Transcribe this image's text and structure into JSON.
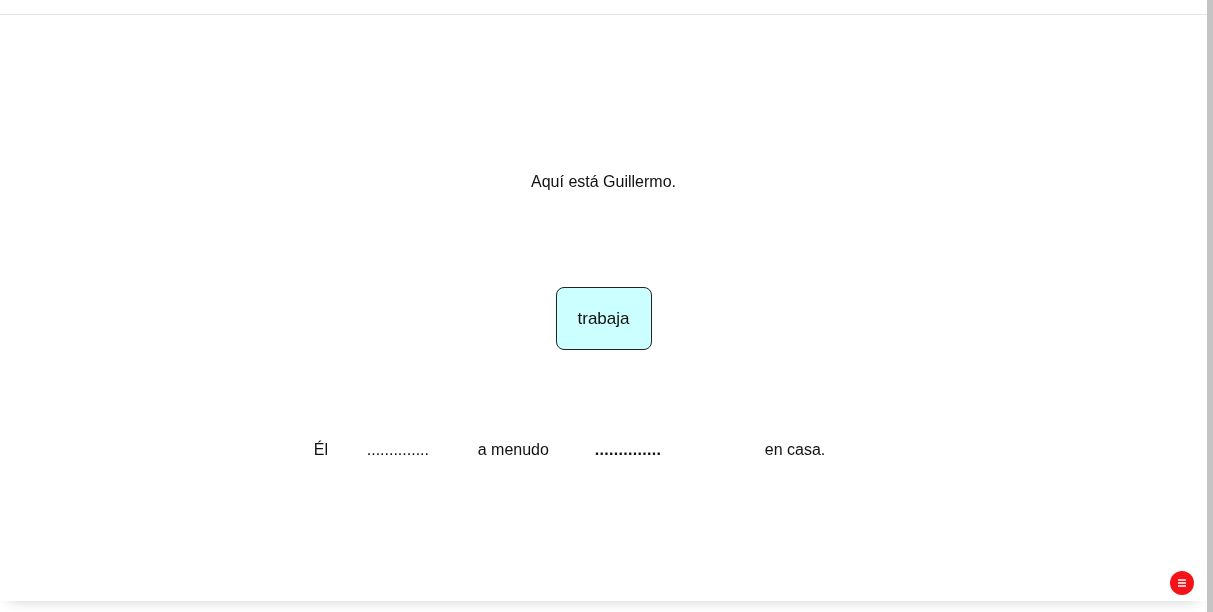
{
  "prompt": "Aquí está Guillermo.",
  "word_card": {
    "label": "trabaja"
  },
  "sentence": [
    {
      "kind": "word",
      "text": "Él"
    },
    {
      "kind": "blank",
      "text": "..............",
      "active": false
    },
    {
      "kind": "word",
      "text": "a menudo"
    },
    {
      "kind": "blank",
      "text": "..............",
      "active": true
    },
    {
      "kind": "word",
      "text": "en casa."
    }
  ]
}
